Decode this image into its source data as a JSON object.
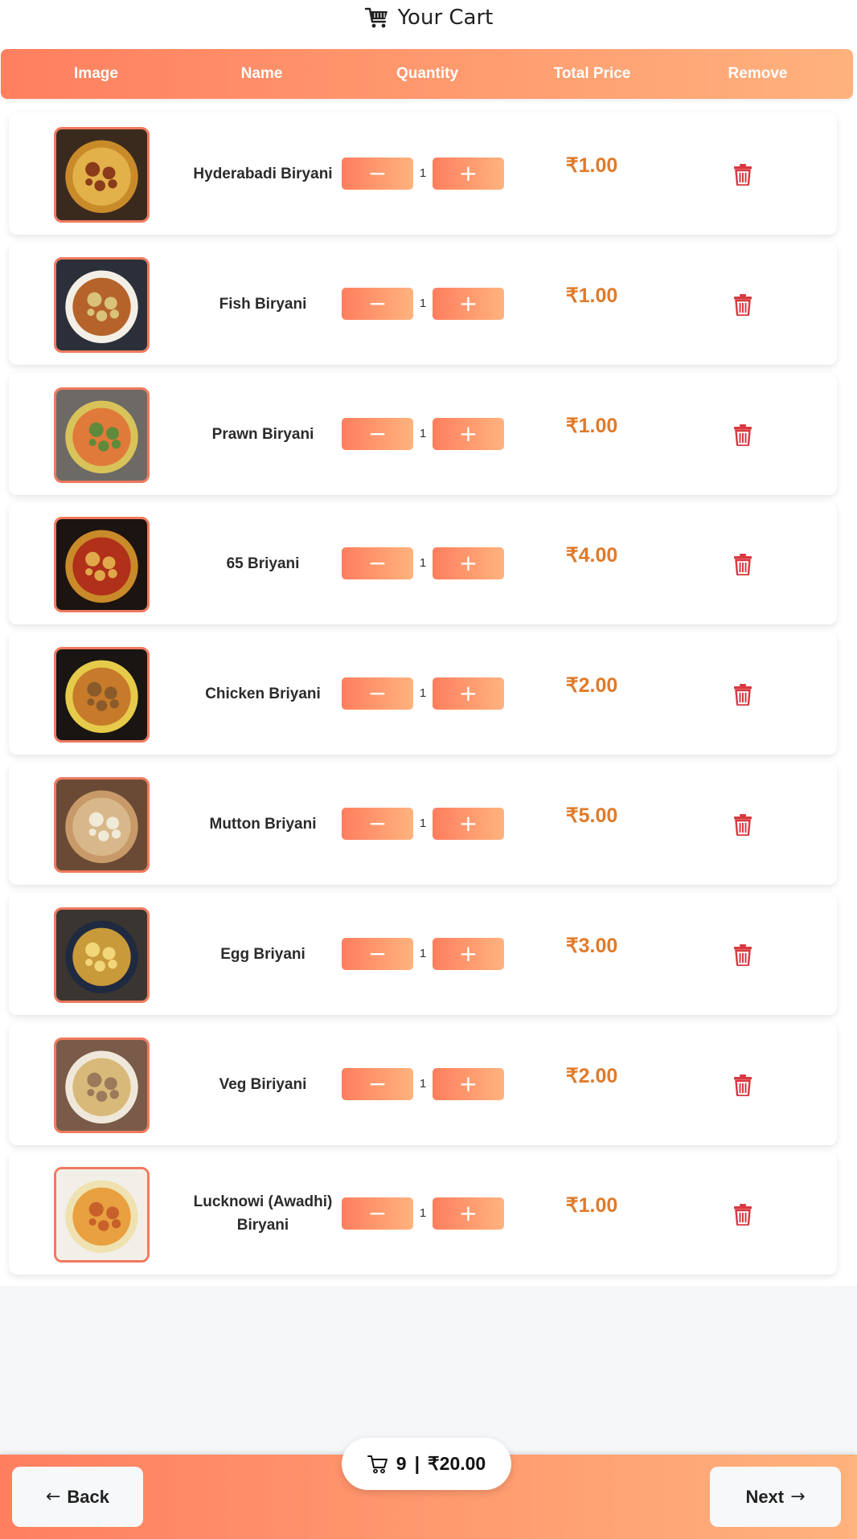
{
  "title": "Your Cart",
  "columns": {
    "image": "Image",
    "name": "Name",
    "quantity": "Quantity",
    "total_price": "Total Price",
    "remove": "Remove"
  },
  "items": [
    {
      "name": "Hyderabadi Biryani",
      "quantity": "1",
      "price": "₹1.00"
    },
    {
      "name": "Fish Biryani",
      "quantity": "1",
      "price": "₹1.00"
    },
    {
      "name": "Prawn Biryani",
      "quantity": "1",
      "price": "₹1.00"
    },
    {
      "name": "65 Briyani",
      "quantity": "1",
      "price": "₹4.00"
    },
    {
      "name": "Chicken Briyani",
      "quantity": "1",
      "price": "₹2.00"
    },
    {
      "name": "Mutton Briyani",
      "quantity": "1",
      "price": "₹5.00"
    },
    {
      "name": "Egg Briyani",
      "quantity": "1",
      "price": "₹3.00"
    },
    {
      "name": "Veg Biriyani",
      "quantity": "1",
      "price": "₹2.00"
    },
    {
      "name": "Lucknowi (Awadhi) Biryani",
      "quantity": "1",
      "price": "₹1.00"
    }
  ],
  "controls": {
    "minus": "−",
    "plus": "+"
  },
  "summary": {
    "count": "9",
    "separator": "|",
    "total": "₹20.00"
  },
  "nav": {
    "back_label": "Back",
    "next_label": "Next",
    "back_arrow": "←",
    "next_arrow": "→"
  },
  "icons": {
    "title_icon": "shopping-cart-icon",
    "remove_icon": "trash-icon",
    "summary_icon": "cart-outline-icon"
  },
  "colors": {
    "accent_start": "#ff7f5f",
    "accent_end": "#ffb27d",
    "price": "#e07a2a",
    "remove": "#d9383f"
  }
}
